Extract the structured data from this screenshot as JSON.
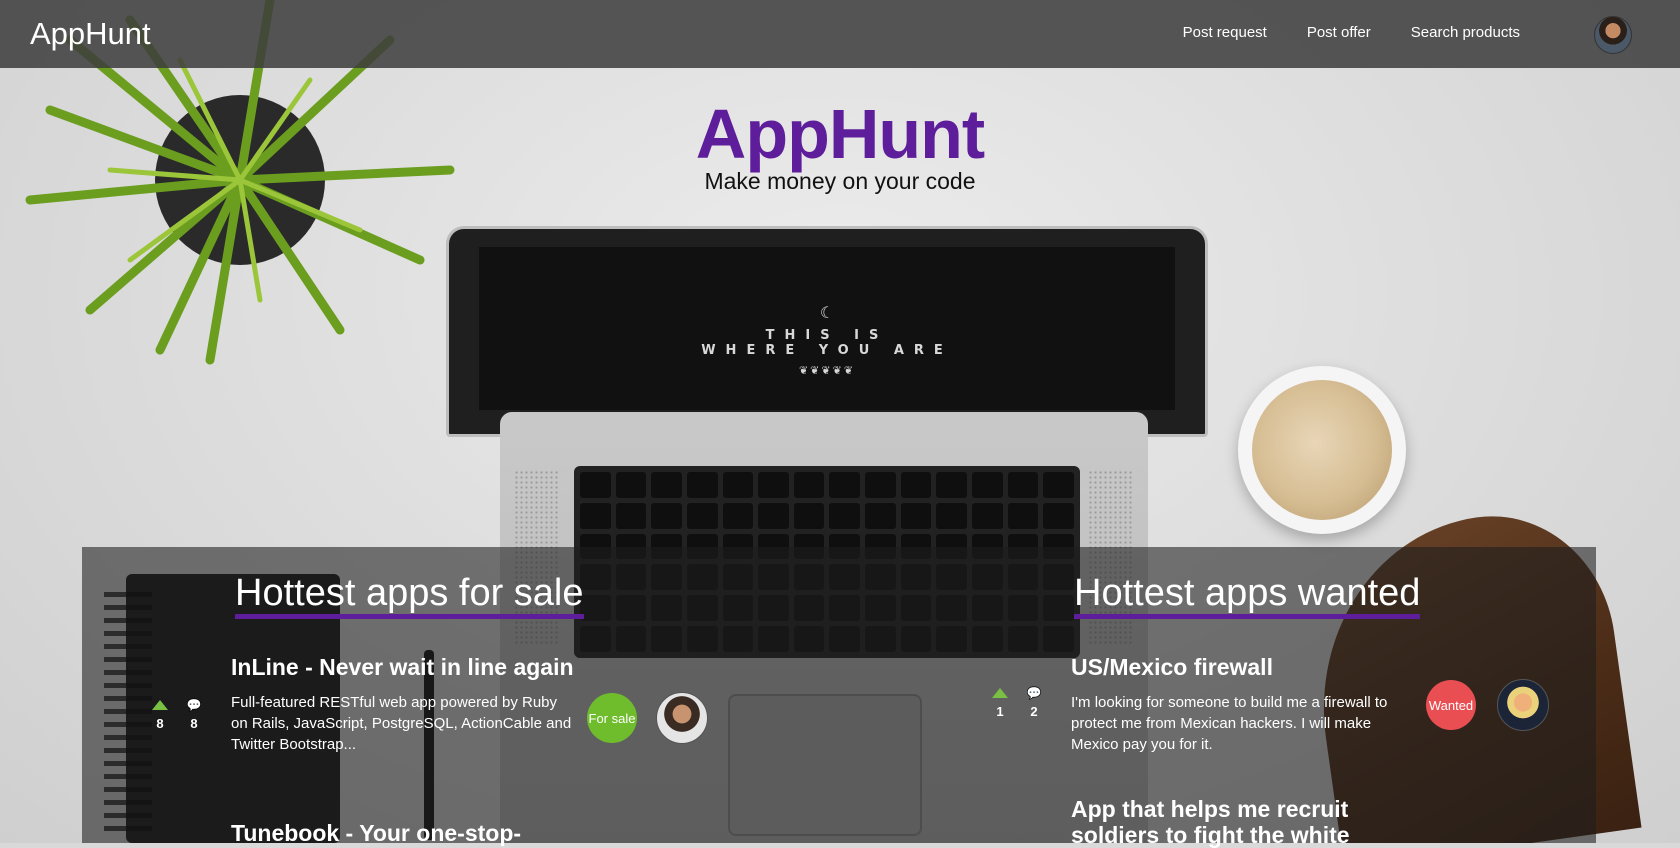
{
  "navbar": {
    "brand": "AppHunt",
    "links": [
      "Post request",
      "Post offer",
      "Search products"
    ]
  },
  "hero": {
    "title": "AppHunt",
    "subtitle": "Make money on your code",
    "laptop_screen": {
      "line1": "THIS IS",
      "line2": "WHERE YOU ARE"
    }
  },
  "for_sale": {
    "heading": "Hottest apps for sale",
    "items": [
      {
        "title": "InLine - Never wait in line again",
        "description": "Full-featured RESTful web app powered by Ruby on Rails, JavaScript, PostgreSQL, ActionCable and Twitter Bootstrap...",
        "upvotes": "8",
        "comments": "8",
        "badge": "For sale"
      },
      {
        "title": "Tunebook - Your one-stop-"
      }
    ]
  },
  "wanted": {
    "heading": "Hottest apps wanted",
    "items": [
      {
        "title": "US/Mexico firewall",
        "description": "I'm looking for someone to build me a firewall to protect me from Mexican hackers. I will make Mexico pay you for it.",
        "upvotes": "1",
        "comments": "2",
        "badge": "Wanted"
      },
      {
        "title": "App that helps me recruit soldiers to fight the white"
      }
    ]
  },
  "colors": {
    "brand_purple": "#5e1d9a",
    "sale_green": "#6fbd2c",
    "wanted_red": "#e94e52",
    "upvote_green": "#7ac143"
  }
}
